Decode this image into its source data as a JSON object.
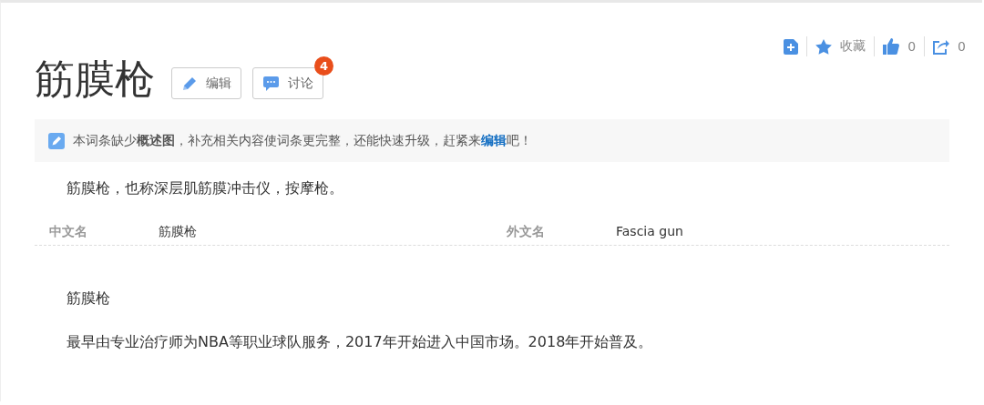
{
  "title": "筋膜枪",
  "title_buttons": [
    {
      "kind": "edit",
      "label": "编辑"
    },
    {
      "kind": "discuss",
      "label": "讨论",
      "badge": "4"
    }
  ],
  "actions": [
    {
      "kind": "add"
    },
    {
      "kind": "favorite",
      "label": "收藏"
    },
    {
      "kind": "like",
      "label": "0"
    },
    {
      "kind": "share",
      "label": "0"
    }
  ],
  "notice": {
    "before": "本词条缺少**概述图**，补充相关内容使词条更完整，还能快速升级，赶紧来",
    "link": "编辑",
    "after": "吧！"
  },
  "summary": "筋膜枪，也称深层肌筋膜冲击仪，按摩枪。",
  "basic_info": [
    {
      "name": "中文名",
      "value": "筋膜枪"
    },
    {
      "name": "外文名",
      "value": "Fascia gun"
    }
  ],
  "paragraphs": [
    "筋膜枪",
    "最早由专业治疗师为NBA等职业球队服务，2017年开始进入中国市场。2018年开始普及。"
  ]
}
